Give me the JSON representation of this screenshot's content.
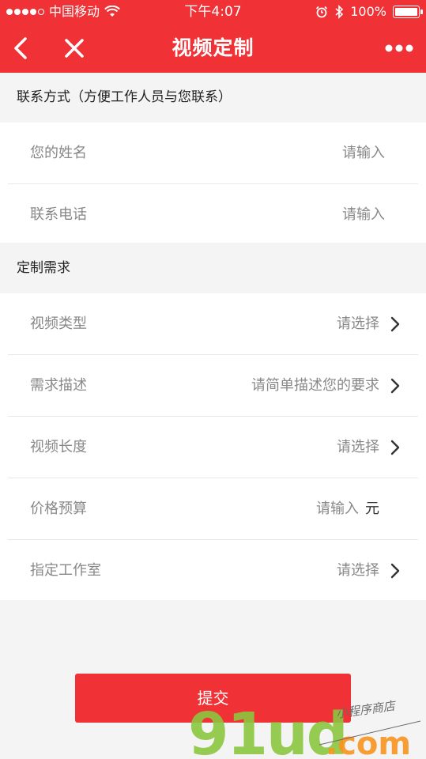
{
  "status_bar": {
    "carrier": "中国移动",
    "time": "下午4:07",
    "battery": "100%"
  },
  "nav": {
    "title": "视频定制"
  },
  "contact_section": {
    "title": "联系方式（方便工作人员与您联系）",
    "rows": [
      {
        "label": "您的姓名",
        "placeholder": "请输入"
      },
      {
        "label": "联系电话",
        "placeholder": "请输入"
      }
    ]
  },
  "requirement_section": {
    "title": "定制需求",
    "rows": [
      {
        "label": "视频类型",
        "placeholder": "请选择"
      },
      {
        "label": "需求描述",
        "placeholder": "请简单描述您的要求"
      },
      {
        "label": "视频长度",
        "placeholder": "请选择"
      },
      {
        "label": "价格预算",
        "placeholder": "请输入",
        "unit": "元"
      },
      {
        "label": "指定工作室",
        "placeholder": "请选择"
      }
    ]
  },
  "submit": {
    "label": "提交"
  },
  "watermark": {
    "brand": "91ud",
    "domain": ".com",
    "tagline": "小程序商店"
  },
  "colors": {
    "accent": "#f03135",
    "watermark_green": "#8cc63f",
    "watermark_orange": "#f7931e"
  }
}
